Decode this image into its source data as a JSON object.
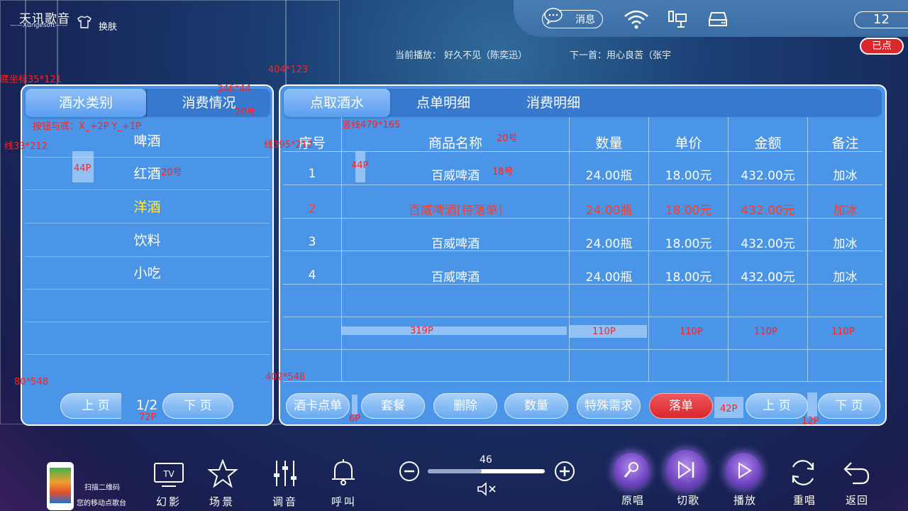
{
  "header": {
    "logo_zh": "天讯歌音",
    "logo_en": "——Xungesoft——",
    "skin_label": "换肤",
    "message_label": "消息",
    "time": "12",
    "booked": "已点",
    "now_playing": "当前播放：  好久不见（陈奕迅）",
    "next_song": "下一首：用心良苦（张宇"
  },
  "left": {
    "tabs": [
      "酒水类别",
      "消费情况"
    ],
    "categories": [
      "啤酒",
      "红酒",
      "洋酒",
      "饮料",
      "小吃"
    ],
    "selected_index": 2,
    "prev": "上 页",
    "next": "下 页",
    "page": "1/2"
  },
  "right": {
    "tabs": [
      "点取酒水",
      "点单明细",
      "消费明细"
    ],
    "columns": [
      "序号",
      "商品名称",
      "数量",
      "单价",
      "金额",
      "备注"
    ],
    "rows": [
      [
        "1",
        "百威啤酒",
        "24.00瓶",
        "18.00元",
        "432.00元",
        "加冰"
      ],
      [
        "2",
        "百威啤酒[待落单]",
        "24.00瓶",
        "18.00元",
        "432.00元",
        "加冰"
      ],
      [
        "3",
        "百威啤酒",
        "24.00瓶",
        "18.00元",
        "432.00元",
        "加冰"
      ],
      [
        "4",
        "百威啤酒",
        "24.00瓶",
        "18.00元",
        "432.00元",
        "加冰"
      ]
    ],
    "pending_row_index": 1,
    "buttons": [
      "酒卡点单",
      "套餐",
      "删除",
      "数量",
      "特殊需求",
      "落单",
      "上 页",
      "下 页"
    ]
  },
  "annotations": {
    "a1": "底坐标35*121",
    "a2": "404*123",
    "a3": "346*44",
    "a4": "20号",
    "a5": "按钮与底：X_+2P Y_+1P",
    "a6": "竖线479*165",
    "a7": "线33*212",
    "a8": "线395*212",
    "a9": "20号",
    "a10": "44P",
    "a11": "20号",
    "a12": "44P",
    "a13": "18号",
    "a14": "319P",
    "a15": "110P",
    "a16": "110P",
    "a17": "110P",
    "a18": "110P",
    "a19": "80*548",
    "a20": "402*548",
    "a21": "72P",
    "a22": "6P",
    "a23": "42P",
    "a24": "12P"
  },
  "bottom": {
    "qr_line1": "扫描二维码",
    "qr_line2": "您的移动点歌台",
    "items": [
      "幻影",
      "场景",
      "调音",
      "呼叫"
    ],
    "tv_label": "TV",
    "volume": "46",
    "controls": [
      "原唱",
      "切歌",
      "播放",
      "重唱",
      "返回"
    ]
  },
  "colors": {
    "panel": "#4a95e8",
    "pending": "#ff3a2a",
    "selected_category": "#ffe94a",
    "place_order": "#d8282c"
  }
}
